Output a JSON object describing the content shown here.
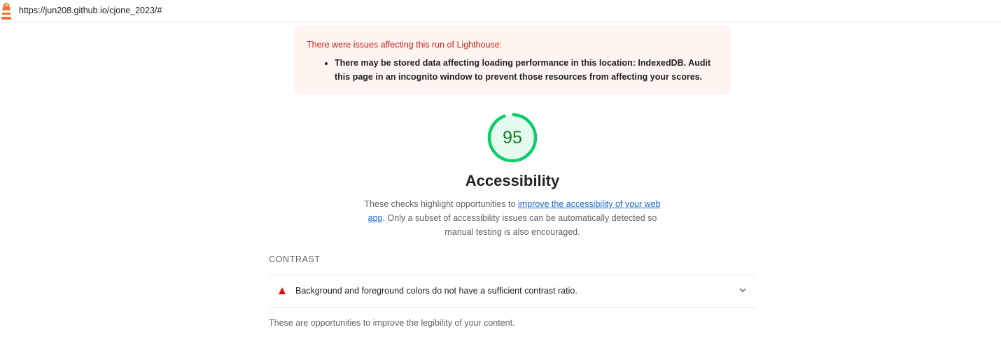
{
  "topbar": {
    "url": "https://jun208.github.io/cjone_2023/#",
    "logo_icon": "lighthouse-icon"
  },
  "warnings": {
    "title": "There were issues affecting this run of Lighthouse:",
    "items": [
      "There may be stored data affecting loading performance in this location: IndexedDB. Audit this page in an incognito window to prevent those resources from affecting your scores."
    ]
  },
  "category": {
    "score": 95,
    "score_fraction": 0.95,
    "score_color": "#0cce6b",
    "title": "Accessibility",
    "description_prefix": "These checks highlight opportunities to ",
    "description_link": "improve the accessibility of your web app",
    "description_suffix": ". Only a subset of accessibility issues can be automatically detected so manual testing is also encouraged."
  },
  "group": {
    "title": "CONTRAST",
    "audits": [
      {
        "status_icon": "fail-triangle-icon",
        "title": "Background and foreground colors do not have a sufficient contrast ratio."
      }
    ],
    "description": "These are opportunities to improve the legibility of your content."
  },
  "colors": {
    "pass_green": "#0cce6b",
    "fail_red": "#eb0f00",
    "warning_bg": "#fff5f0",
    "link_blue": "#1967d2"
  }
}
